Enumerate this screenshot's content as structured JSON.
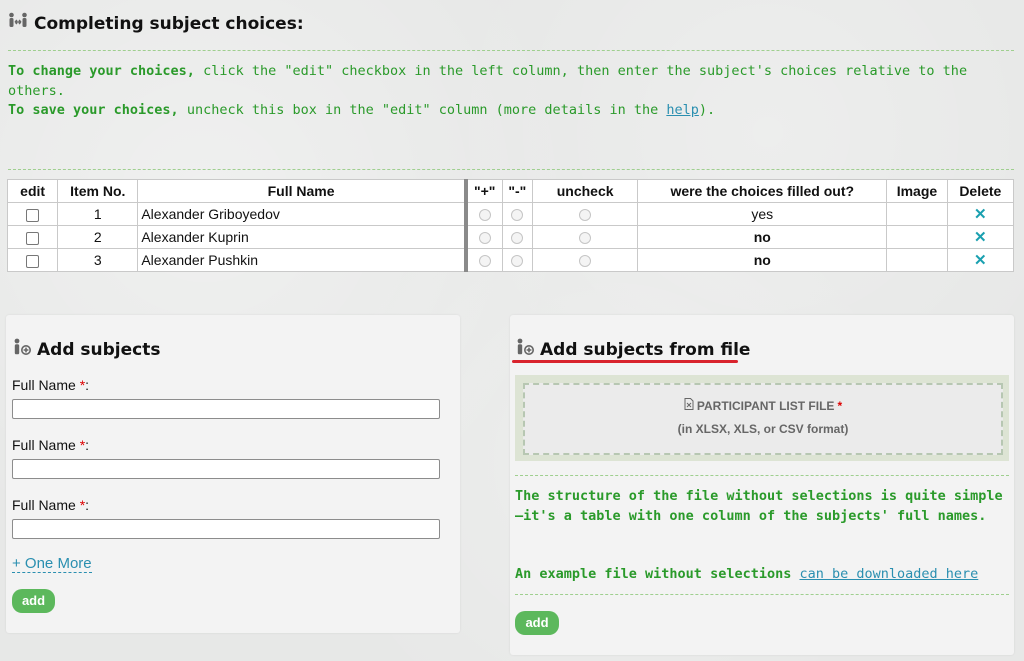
{
  "header": {
    "title": "Completing subject choices:"
  },
  "instructions": {
    "line1_bold": "To change your choices,",
    "line1_rest": " click the \"edit\" checkbox in the left column, then enter the subject's choices relative to the others.",
    "line2_bold": "To save your choices,",
    "line2_rest": " uncheck this box in the \"edit\" column (more details in the ",
    "help_link": "help",
    "line2_end": ")."
  },
  "table": {
    "columns": [
      "edit",
      "Item No.",
      "Full Name",
      "\"+\"",
      "\"-\"",
      "uncheck",
      "were the choices filled out?",
      "Image",
      "Delete"
    ],
    "rows": [
      {
        "item_no": "1",
        "full_name": "Alexander Griboyedov",
        "filled": "yes",
        "delete": "✕"
      },
      {
        "item_no": "2",
        "full_name": "Alexander Kuprin",
        "filled": "no",
        "delete": "✕"
      },
      {
        "item_no": "3",
        "full_name": "Alexander Pushkin",
        "filled": "no",
        "delete": "✕"
      }
    ]
  },
  "add_subjects": {
    "title": "Add subjects",
    "field_label": "Full Name",
    "required_mark": "*",
    "colon": ":",
    "one_more": "+ One More",
    "add_button": "add"
  },
  "add_from_file": {
    "title": "Add subjects from file",
    "dropzone_label": "PARTICIPANT LIST FILE",
    "required_mark": "*",
    "dropzone_format": "(in XLSX, XLS, or CSV format)",
    "description": "The structure of the file without selections is quite simple—it's a table with one column of the subjects' full names.",
    "example_text": "An example file without selections ",
    "example_link": "can be downloaded here",
    "add_button": "add"
  },
  "colors": {
    "green_text": "#2a9a2a",
    "link": "#2a8fb0",
    "button": "#5cb85c",
    "accent_red": "#d9232d"
  }
}
